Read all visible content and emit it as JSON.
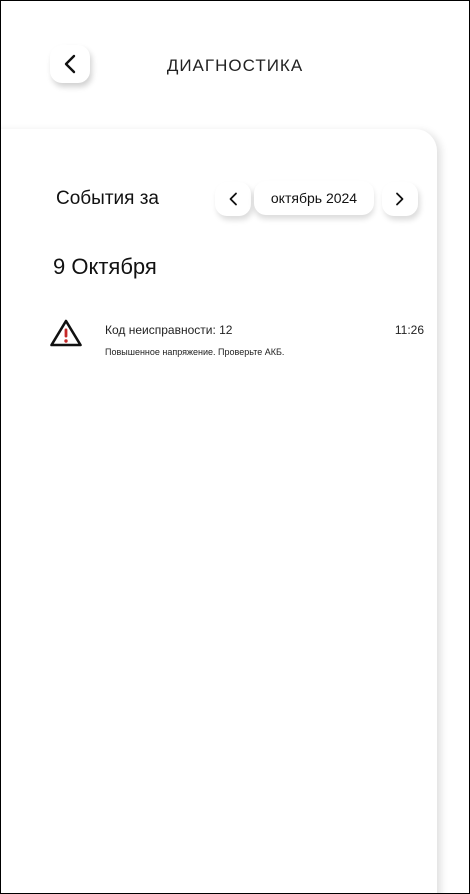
{
  "header": {
    "title": "ДИАГНОСТИКА",
    "back_icon": "chevron-left-icon"
  },
  "period": {
    "label": "События за",
    "month": "октябрь 2024",
    "prev_icon": "chevron-left-icon",
    "next_icon": "chevron-right-icon"
  },
  "events": {
    "day": "9 Октября",
    "items": [
      {
        "icon": "warning-icon",
        "title": "Код неисправности: 12",
        "description": "Повышенное напряжение. Проверьте АКБ.",
        "time": "11:26"
      }
    ]
  },
  "colors": {
    "warning_accent": "#c62828",
    "text": "#222222"
  }
}
